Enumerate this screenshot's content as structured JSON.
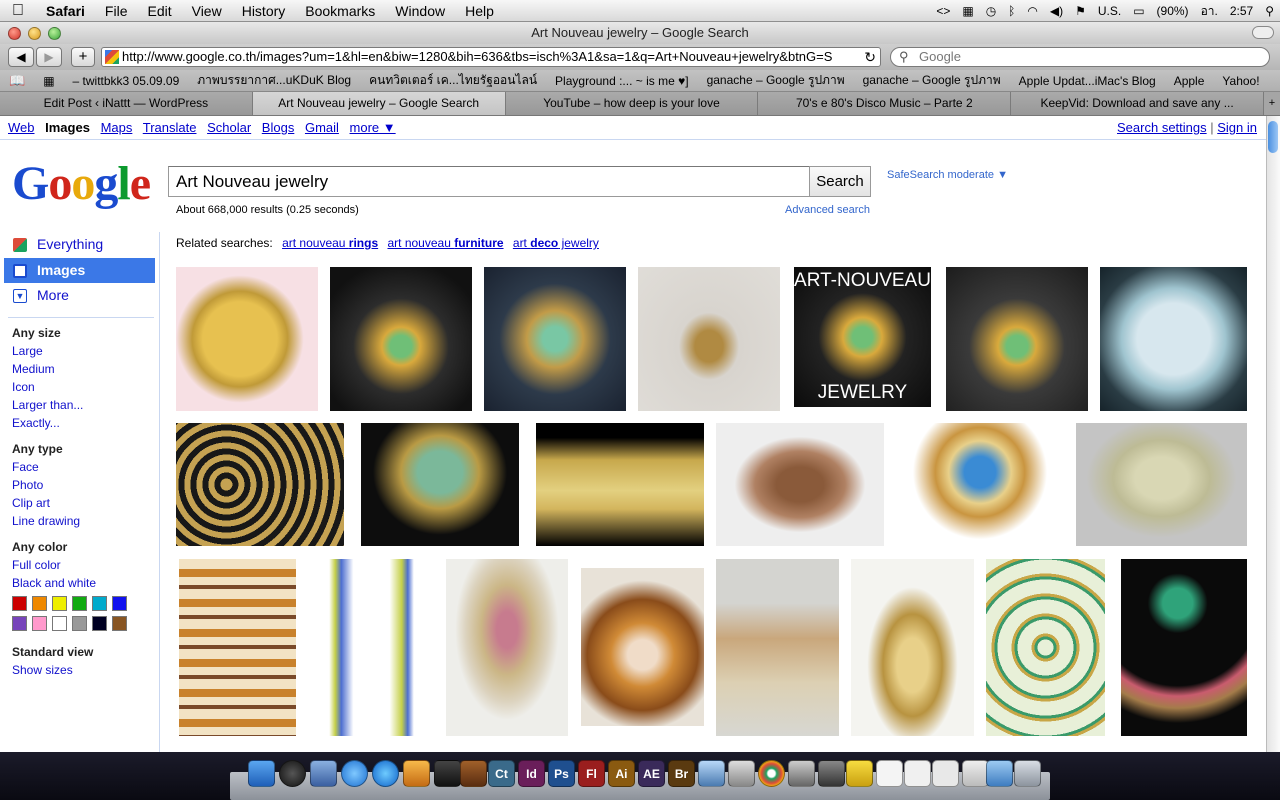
{
  "menubar": {
    "app": "Safari",
    "items": [
      "File",
      "Edit",
      "View",
      "History",
      "Bookmarks",
      "Window",
      "Help"
    ],
    "status": {
      "input_source": "U.S.",
      "battery": "(90%)",
      "day": "อา.",
      "time": "2:57"
    }
  },
  "window": {
    "title": "Art Nouveau jewelry – Google Search"
  },
  "toolbar": {
    "url": "http://www.google.co.th/images?um=1&hl=en&biw=1280&bih=636&tbs=isch%3A1&sa=1&q=Art+Nouveau+jewelry&btnG=S",
    "search_placeholder": "Google"
  },
  "bookmarks": [
    "– twittbkk3 05.09.09",
    "ภาพบรรยากาศ...uKDuK Blog",
    "คนทวิตเตอร์ เค...ไทยรัฐออนไลน์",
    "Playground :... ~ is me ♥]",
    "ganache – Google รูปภาพ",
    "ganache – Google รูปภาพ",
    "Apple Updat...iMac's Blog",
    "Apple",
    "Yahoo!"
  ],
  "tabs": [
    "Edit Post ‹ iNattt — WordPress",
    "Art Nouveau jewelry – Google Search",
    "YouTube – how deep is your love",
    "70's e 80's Disco Music – Parte 2",
    "KeepVid: Download and save any ..."
  ],
  "gbar": {
    "links": [
      "Web",
      "Images",
      "Maps",
      "Translate",
      "Scholar",
      "Blogs",
      "Gmail",
      "more ▼"
    ],
    "search_settings": "Search settings",
    "sign_in": "Sign in"
  },
  "search": {
    "query": "Art Nouveau jewelry",
    "button": "Search",
    "safesearch": "SafeSearch moderate ▼",
    "stats": "About 668,000 results (0.25 seconds)",
    "advanced": "Advanced search"
  },
  "leftnav": {
    "modes": [
      "Everything",
      "Images",
      "More"
    ],
    "size_header": "Any size",
    "sizes": [
      "Large",
      "Medium",
      "Icon",
      "Larger than...",
      "Exactly..."
    ],
    "type_header": "Any type",
    "types": [
      "Face",
      "Photo",
      "Clip art",
      "Line drawing"
    ],
    "color_header": "Any color",
    "colors": [
      "Full color",
      "Black and white"
    ],
    "swatches": [
      "#cc0000",
      "#ee8800",
      "#eeee00",
      "#11aa11",
      "#00aacc",
      "#1111ee",
      "#7744bb",
      "#ff99cc",
      "#ffffff",
      "#999999",
      "#000022",
      "#885522"
    ],
    "view_header": "Standard view",
    "view_link": "Show sizes"
  },
  "related": {
    "label": "Related searches:",
    "items": [
      {
        "pre": "art nouveau ",
        "bold": "rings"
      },
      {
        "pre": "art nouveau ",
        "bold": "furniture"
      },
      {
        "pre": "art ",
        "bold": "deco",
        "post": " jewelry"
      }
    ]
  },
  "results": {
    "caption_top": "ART-NOUVEAU",
    "caption_bottom": "JEWELRY"
  }
}
